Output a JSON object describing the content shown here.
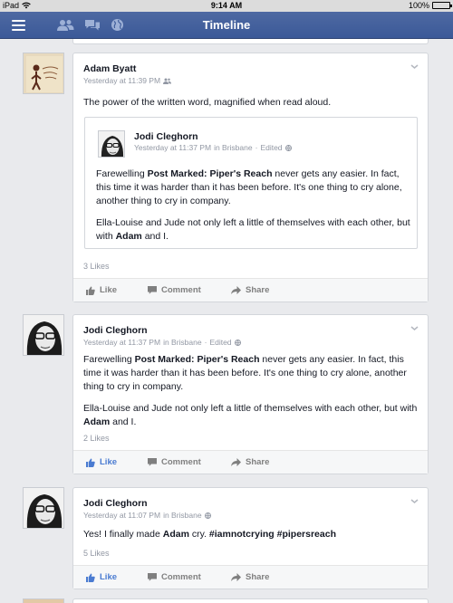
{
  "status_bar": {
    "device": "iPad",
    "time": "9:14 AM",
    "battery": "100%"
  },
  "nav": {
    "title": "Timeline",
    "icons": [
      "menu-icon",
      "friends-icon",
      "messages-icon",
      "globe-icon"
    ]
  },
  "posts": [
    {
      "author": "Adam Byatt",
      "time": "Yesterday at 11:39 PM",
      "audience_icon": "friends-icon",
      "text": "The power of the written word, magnified when read aloud.",
      "likes": "3 Likes",
      "shared": {
        "author": "Jodi Cleghorn",
        "time": "Yesterday at 11:37 PM",
        "location": "in Brisbane",
        "edited": "Edited",
        "paragraphs": [
          [
            "Farewelling ",
            "Post Marked: Piper's Reach",
            " never gets any easier. In fact, this time it was harder than it has been before. It's one thing to cry alone, another thing to cry in company."
          ],
          [
            "Ella-Louise and Jude not only left a little of themselves with each other, but with ",
            "Adam",
            " and I."
          ]
        ]
      },
      "liked": false
    },
    {
      "author": "Jodi Cleghorn",
      "time": "Yesterday at 11:37 PM",
      "location": "in Brisbane",
      "edited": "Edited",
      "paragraphs": [
        [
          "Farewelling ",
          "Post Marked: Piper's Reach",
          " never gets any easier. In fact, this time it was harder than it has been before. It's one thing to cry alone, another thing to cry in company."
        ],
        [
          "Ella-Louise and Jude not only left a little of themselves with each other, but with ",
          "Adam",
          " and I."
        ]
      ],
      "likes": "2 Likes",
      "liked": true
    },
    {
      "author": "Jodi Cleghorn",
      "time": "Yesterday at 11:07 PM",
      "location": "in Brisbane",
      "text_parts": [
        "Yes! I finally made ",
        "Adam",
        " cry. ",
        "#iamnotcrying",
        " ",
        "#pipersreach"
      ],
      "likes": "5 Likes",
      "liked": true
    }
  ],
  "actions": {
    "like": "Like",
    "comment": "Comment",
    "share": "Share"
  },
  "colors": {
    "navbar": "#3b5998",
    "background": "#e9eaed",
    "liked": "#4a7bd1",
    "muted": "#9197a3"
  }
}
